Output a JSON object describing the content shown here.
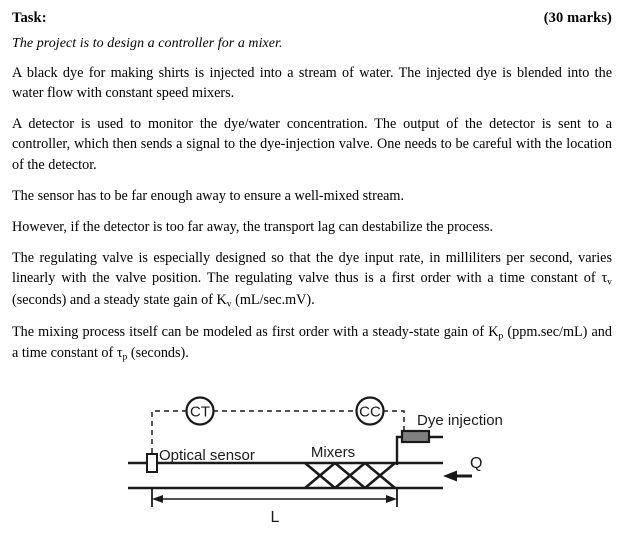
{
  "header": {
    "task_label": "Task:",
    "marks": "(30 marks)"
  },
  "subtitle": "The project is to design a controller for a mixer.",
  "paragraphs": [
    "A black dye for making shirts is injected into a stream of water. The injected dye is blended into the water flow with constant speed mixers.",
    "A detector is used to monitor the dye/water concentration. The output of the detector is sent to a controller, which then sends a signal to the dye-injection valve. One needs to be careful with the location of the detector.",
    "The sensor has to be far enough away to ensure a well-mixed stream.",
    "However, if the detector is too far away, the transport lag can destabilize the process."
  ],
  "paragraph_valve": {
    "part1": "The regulating valve is especially designed so that the dye input rate, in milliliters per second, varies linearly with the valve position. The regulating valve thus is a first order with a time constant of ",
    "tau_symbol": "τ",
    "tau_sub": "v",
    "part2": " (seconds) and a steady state gain of K",
    "k_sub": "v",
    "part3": " (mL/sec.mV)."
  },
  "paragraph_process": {
    "part1": "The mixing process itself can be modeled as first order with a steady-state gain of K",
    "k_sub": "p",
    "part2": " (ppm.sec/mL) and a time constant of ",
    "tau_symbol": "τ",
    "tau_sub": "p",
    "part3": " (seconds)."
  },
  "diagram": {
    "transmitter_label": "CT",
    "controller_label": "CC",
    "sensor_label": "Optical sensor",
    "mixers_label": "Mixers",
    "dye_injection_label": "Dye injection",
    "flow_label": "Q",
    "length_label": "L",
    "colors": {
      "line": "#1a1a1a",
      "valve_fill": "#808080",
      "dashed": "#3a3a3a"
    }
  }
}
